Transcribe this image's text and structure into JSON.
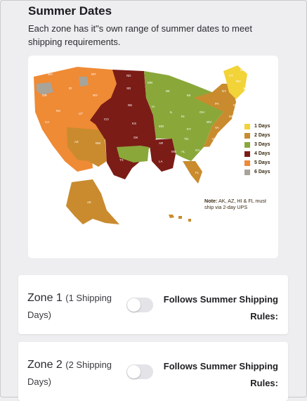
{
  "section": {
    "title": "Summer Dates",
    "description": "Each zone has it\"s own range of summer dates to meet shipping requirements."
  },
  "map": {
    "legend": [
      {
        "label": "1 Days",
        "color": "#f2d338"
      },
      {
        "label": "2 Days",
        "color": "#c98b2e"
      },
      {
        "label": "3 Days",
        "color": "#8aa83a"
      },
      {
        "label": "4 Days",
        "color": "#7b1c17"
      },
      {
        "label": "5 Days",
        "color": "#ef8a35"
      },
      {
        "label": "6 Days",
        "color": "#a8a49a"
      }
    ],
    "note_bold": "Note:",
    "note_text": " AK, AZ, HI & FL must ship via 2-day UPS",
    "state_labels": [
      "WA",
      "OR",
      "CA",
      "NV",
      "ID",
      "MT",
      "WY",
      "UT",
      "AZ",
      "NM",
      "CO",
      "ND",
      "SD",
      "NE",
      "KS",
      "OK",
      "TX",
      "MN",
      "IA",
      "MO",
      "AR",
      "LA",
      "WI",
      "IL",
      "MS",
      "AL",
      "MI",
      "IN",
      "KY",
      "TN",
      "GA",
      "FL",
      "OH",
      "WV",
      "VA",
      "NC",
      "SC",
      "PA",
      "NY",
      "ME",
      "VT",
      "NH",
      "MA",
      "CT",
      "RI",
      "NJ",
      "DE",
      "MD",
      "AK",
      "HI"
    ]
  },
  "zones": [
    {
      "name": "Zone 1",
      "days": "(1 Shipping Days)",
      "rule": "Follows Summer Shipping Rules:",
      "enabled": false
    },
    {
      "name": "Zone 2",
      "days": "(2 Shipping Days)",
      "rule": "Follows Summer Shipping Rules:",
      "enabled": false
    }
  ]
}
